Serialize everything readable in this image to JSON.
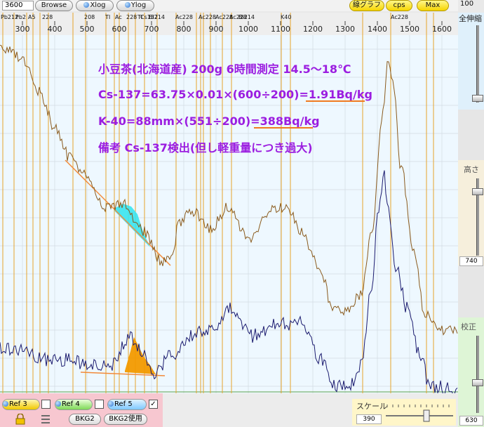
{
  "toolbar": {
    "counter_value": "3600",
    "browse_label": "Browse",
    "xlog_label": "Xlog",
    "ylog_label": "Ylog",
    "graph_type_label": "線グラフ",
    "cps_label": "cps",
    "max_label": "Max",
    "right_value": "100"
  },
  "axis": {
    "ticks": [
      "300",
      "400",
      "500",
      "600",
      "700",
      "800",
      "900",
      "1000",
      "1100",
      "1200",
      "1300",
      "1400",
      "1500",
      "1600"
    ],
    "peak_labels": [
      "Pb212",
      "Pb2",
      "A5",
      "228",
      "TI",
      "208",
      "Ac",
      "228",
      "TI",
      "Bi214",
      "Cs137",
      "Ac228",
      "Ac228",
      "Ac228",
      "Ac228",
      "Bi214",
      "K40",
      "Ac228"
    ]
  },
  "annotations": {
    "line1": "小豆茶(北海道産) 200g 6時間測定  14.5〜18℃",
    "line2_prefix": "Cs-137=63.75×0.01×(600÷200)=",
    "line2_result": "1.91Bq/kg",
    "line3_prefix": "K-40=88mm×(551÷200)=",
    "line3_result": "388Bq/kg",
    "line4": "備考    Cs-137検出(但し軽重量につき過大)"
  },
  "right_panel": {
    "overall_label": "全伸縮",
    "height_label": "高さ",
    "height_value": "740",
    "calibration_label": "校正",
    "calibration_value": "630"
  },
  "bottom": {
    "ref3_label": "Ref 3",
    "ref4_label": "Ref 4",
    "ref5_label": "Ref 5",
    "ref5_checked": "✓",
    "bkg2_label": "BKG2",
    "bkg2_use_label": "BKG2使用",
    "scale_label": "スケール",
    "scale_value": "390"
  },
  "colors": {
    "spectrum_upper": "#8a5a1c",
    "spectrum_lower": "#1a1a6e",
    "marker_lines": "#e6a42b",
    "annotation_text": "#9b1de0",
    "underline": "#f07a20",
    "cs_fill_upper": "#39e4ef",
    "cs_fill_lower": "#f29a00"
  }
}
